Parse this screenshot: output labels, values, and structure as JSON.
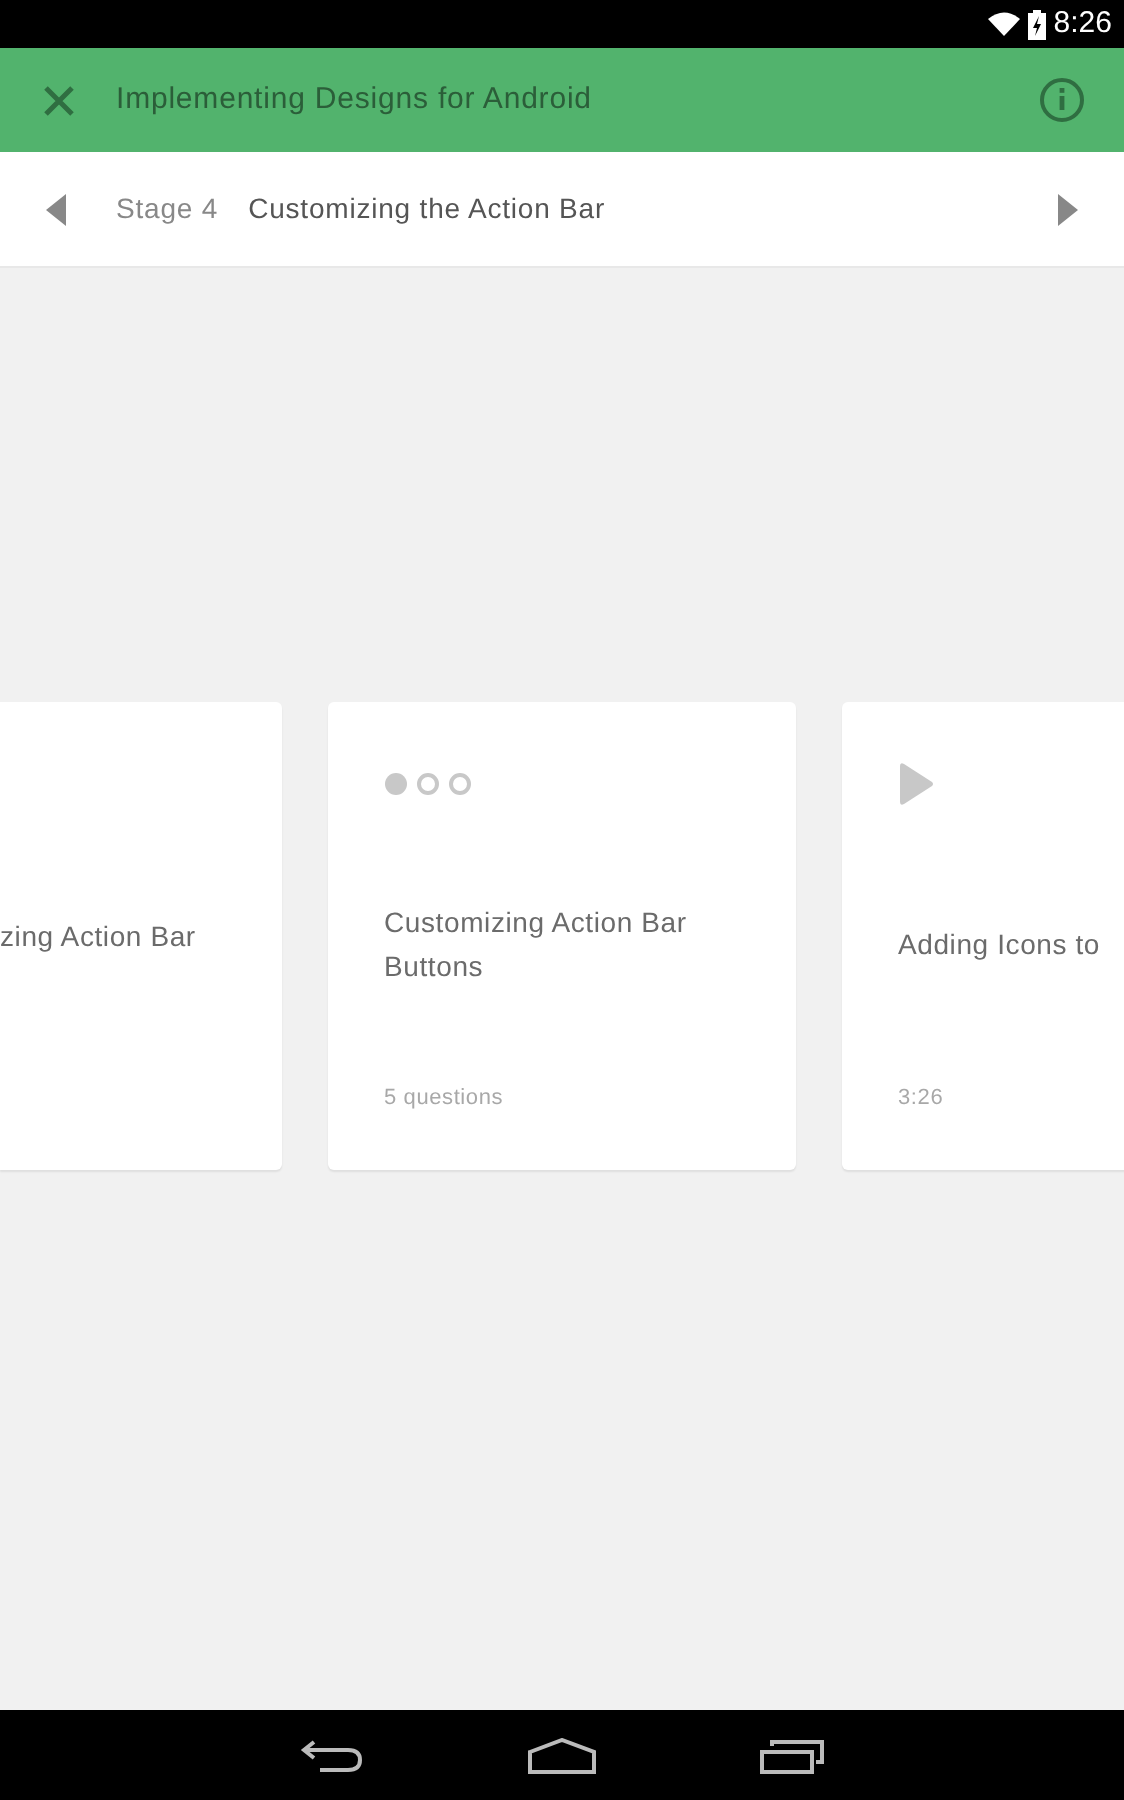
{
  "status_bar": {
    "time": "8:26"
  },
  "app_bar": {
    "title": "Implementing Designs for Android"
  },
  "stage_bar": {
    "stage": "Stage 4",
    "title": "Customizing the Action Bar"
  },
  "cards": [
    {
      "kind": "partial",
      "title": "zing Action Bar"
    },
    {
      "kind": "quiz",
      "title": "Customizing Action Bar Buttons",
      "meta": "5 questions"
    },
    {
      "kind": "video",
      "title": "Adding Icons to",
      "meta": "3:26"
    }
  ]
}
